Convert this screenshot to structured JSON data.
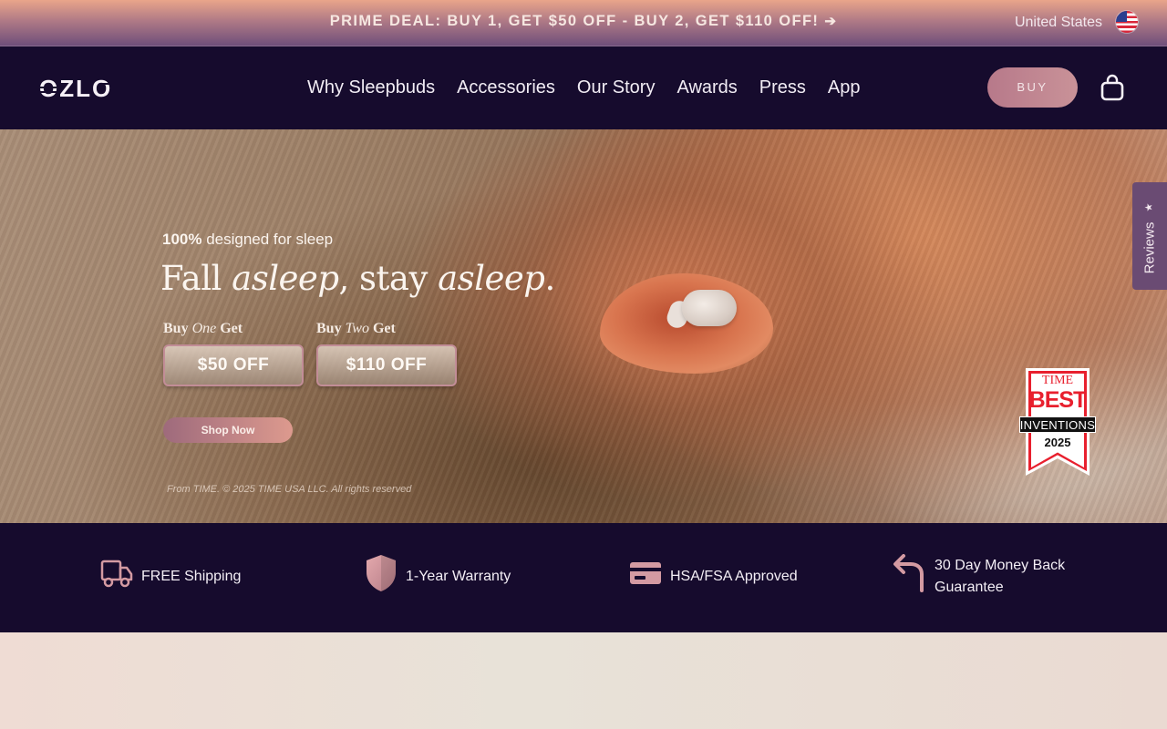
{
  "announcement": {
    "deal_text": "PRIME DEAL: BUY 1, GET $50 OFF - BUY 2, GET $110 OFF!",
    "arrow_icon": "arrow-right-icon",
    "country": "United States",
    "flag_icon": "us-flag-icon"
  },
  "header": {
    "logo_text": "OZLO",
    "nav": [
      "Why Sleepbuds",
      "Accessories",
      "Our Story",
      "Awards",
      "Press",
      "App"
    ],
    "buy_label": "BUY",
    "cart_icon": "shopping-bag-icon"
  },
  "hero": {
    "eyebrow_bold": "100%",
    "eyebrow_rest": " designed for sleep",
    "title_parts": [
      "Fall ",
      "asleep",
      ", stay ",
      "asleep",
      "."
    ],
    "offers": [
      {
        "label_pre": "Buy ",
        "label_em": "One",
        "label_post": " Get",
        "amount": "$50 OFF"
      },
      {
        "label_pre": "Buy ",
        "label_em": "Two",
        "label_post": " Get",
        "amount": "$110 OFF"
      }
    ],
    "cta_label": "Shop Now",
    "copyright": "From TIME. © 2025 TIME USA LLC. All rights reserved",
    "badge": {
      "line1": "TIME",
      "line2": "BEST",
      "line3": "INVENTIONS",
      "line4": "2025"
    }
  },
  "reviews_tab": {
    "label": "Reviews",
    "icon": "star-icon"
  },
  "features": [
    {
      "icon": "truck-icon",
      "text": "FREE Shipping"
    },
    {
      "icon": "shield-icon",
      "text": "1-Year Warranty"
    },
    {
      "icon": "credit-card-icon",
      "text": "HSA/FSA Approved"
    },
    {
      "icon": "return-arrow-icon",
      "text": "30 Day Money Back Guarantee"
    }
  ],
  "colors": {
    "header_bg": "#160b2d",
    "accent_pink": "#c99298",
    "icon_pink": "#d49aa2"
  }
}
